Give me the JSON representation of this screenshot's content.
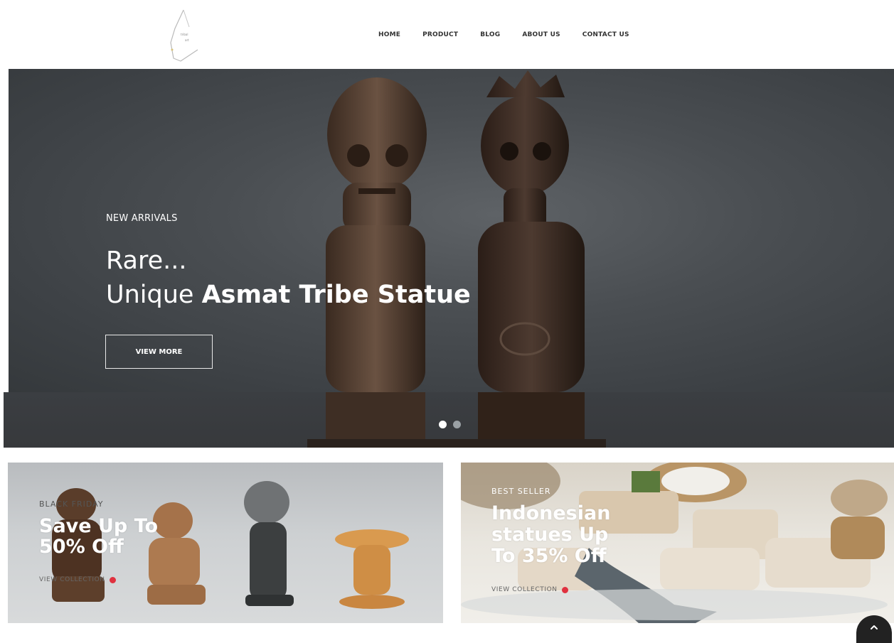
{
  "header": {
    "logo_label": "Indonesia Tribal Art logo",
    "nav": [
      {
        "label": "HOME"
      },
      {
        "label": "PRODUCT"
      },
      {
        "label": "BLOG"
      },
      {
        "label": "ABOUT US"
      },
      {
        "label": "CONTACT US"
      }
    ]
  },
  "hero": {
    "kicker": "NEW ARRIVALS",
    "line1": "Rare...",
    "line2_regular": "Unique ",
    "line2_bold": "Asmat Tribe Statue",
    "button_label": "VIEW MORE",
    "slide_count": 2,
    "active_slide": 1
  },
  "banners": [
    {
      "kicker": "BLACK FRIDAY",
      "title_line1": "Save Up To",
      "title_line2": "50% Off",
      "link_label": "VIEW COLLECTION"
    },
    {
      "kicker": "BEST SELLER",
      "title_line1": "Indonesian",
      "title_line2": "statues Up",
      "title_line3": "To 35% Off",
      "link_label": "VIEW COLLECTION"
    }
  ],
  "colors": {
    "nav_text": "#333333",
    "hero_bg": "#4a4e52",
    "accent_dot": "#e0313f",
    "scroll_button": "#222222"
  },
  "icons": {
    "scroll_top": "chevron-up-icon"
  }
}
